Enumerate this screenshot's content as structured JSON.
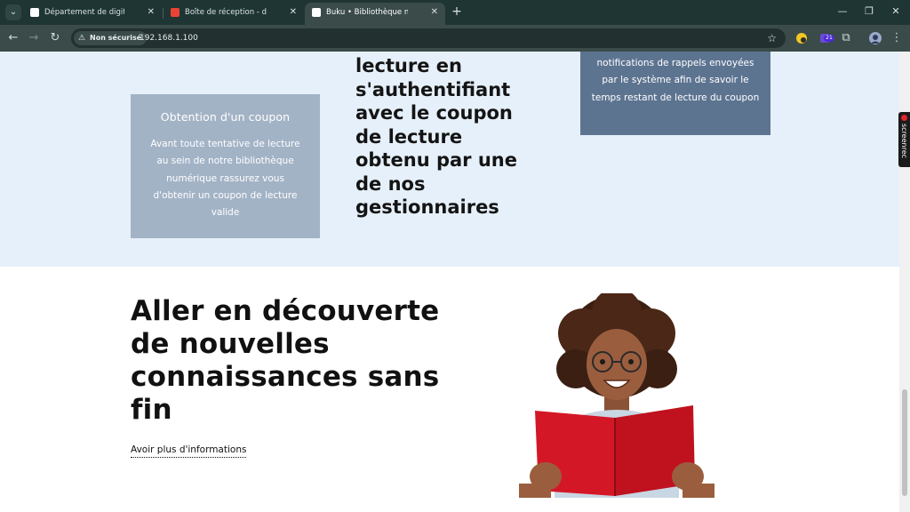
{
  "browser": {
    "tabs": [
      {
        "title": "Département de digitalisation |",
        "favicon_color": "#ffffff"
      },
      {
        "title": "Boîte de réception - developpe",
        "favicon_color": "#ea4335"
      },
      {
        "title": "Buku • Bibliothèque numérique",
        "favicon_color": "#ffffff"
      }
    ],
    "active_tab_index": 2,
    "tab_close_glyph": "✕",
    "new_tab_glyph": "+",
    "security_label": "Non sécurisé",
    "url": "192.168.1.100",
    "extension_badge": "21"
  },
  "page": {
    "card_left": {
      "title": "Obtention d'un coupon",
      "text": "Avant toute tentative de lecture au sein de notre bibliothèque numérique rassurez vous d'obtenir un coupon de lecture valide"
    },
    "middle_text": "lecture en s'authentifiant avec le coupon de lecture obtenu par une de nos gestionnaires",
    "card_right": {
      "text": "notifications de rappels envoyées par le système afin de savoir le temps restant de lecture du coupon"
    },
    "hero": {
      "title": "Aller en découverte de nouvelles connaissances sans fin",
      "link": "Avoir plus d'informations"
    },
    "screenrec_label": "screenrec"
  },
  "colors": {
    "band": "#e6f0fa",
    "card_left": "#a3b3c6",
    "card_right": "#5d7491",
    "book": "#d41726"
  },
  "icons": [
    "tab-search-icon",
    "warning-icon",
    "star-icon",
    "back-icon",
    "forward-icon",
    "reload-icon",
    "puzzle-icon",
    "more-icon",
    "minimize-icon",
    "maximize-icon",
    "close-icon"
  ]
}
